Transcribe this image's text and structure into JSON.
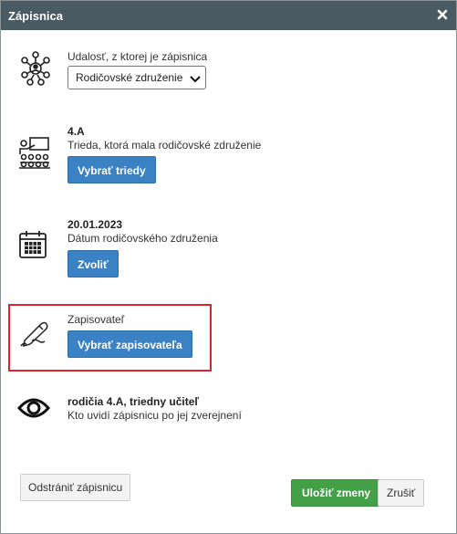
{
  "dialog": {
    "title": "Zápisnica",
    "close_icon": "close-icon"
  },
  "event": {
    "label": "Udalosť, z ktorej je zápisnica",
    "selected": "Rodičovské združenie",
    "icon": "group-meeting-icon"
  },
  "class": {
    "value": "4.A",
    "description": "Trieda, ktorá mala rodičovské združenie",
    "button": "Vybrať triedy",
    "icon": "classroom-icon"
  },
  "date": {
    "value": "20.01.2023",
    "description": "Dátum rodičovského združenia",
    "button": "Zvoliť",
    "icon": "calendar-icon"
  },
  "recorder": {
    "label": "Zapisovateľ",
    "button": "Vybrať zapisovateľa",
    "icon": "pen-writing-icon"
  },
  "visibility": {
    "value": "rodičia 4.A, triedny učiteľ",
    "description": "Kto uvidí zápisnicu po jej zverejnení",
    "icon": "eye-icon"
  },
  "footer": {
    "delete": "Odstrániť zápisnicu",
    "save": "Uložiť zmeny",
    "cancel": "Zrušiť"
  },
  "colors": {
    "titlebar": "#4a5a63",
    "primary_button": "#3b82c4",
    "save_button": "#43a047",
    "highlight": "#d9252e"
  }
}
